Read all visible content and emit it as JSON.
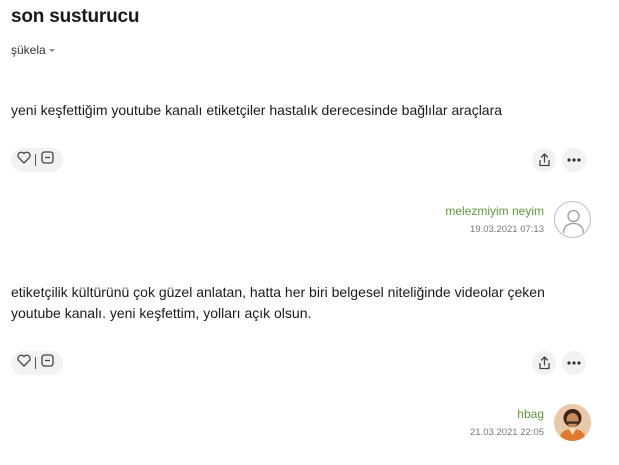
{
  "topic": {
    "title": "son susturucu",
    "sort_label": "şükela"
  },
  "entries": [
    {
      "text": "yeni keşfettiğim youtube kanalı etiketçiler hastalık derecesinde bağlılar araçlara",
      "author": "melezmiyim neyim",
      "date": "19.03.2021 07:13",
      "avatar_icon": "default-user-avatar"
    },
    {
      "text": "etiketçilik kültürünü çok güzel anlatan, hatta her biri belgesel niteliğinde videolar çeken youtube kanalı. yeni keşfettim, yolları açık olsun.",
      "author": "hbag",
      "date": "21.03.2021 22:05",
      "avatar_icon": "photo-avatar"
    }
  ],
  "icons": {
    "like": "heart-icon",
    "dislike": "minus-square-icon",
    "share": "share-icon",
    "more": "more-dots-icon"
  },
  "colors": {
    "author": "#5d9a3b",
    "pill_bg": "#f2f2f2"
  }
}
